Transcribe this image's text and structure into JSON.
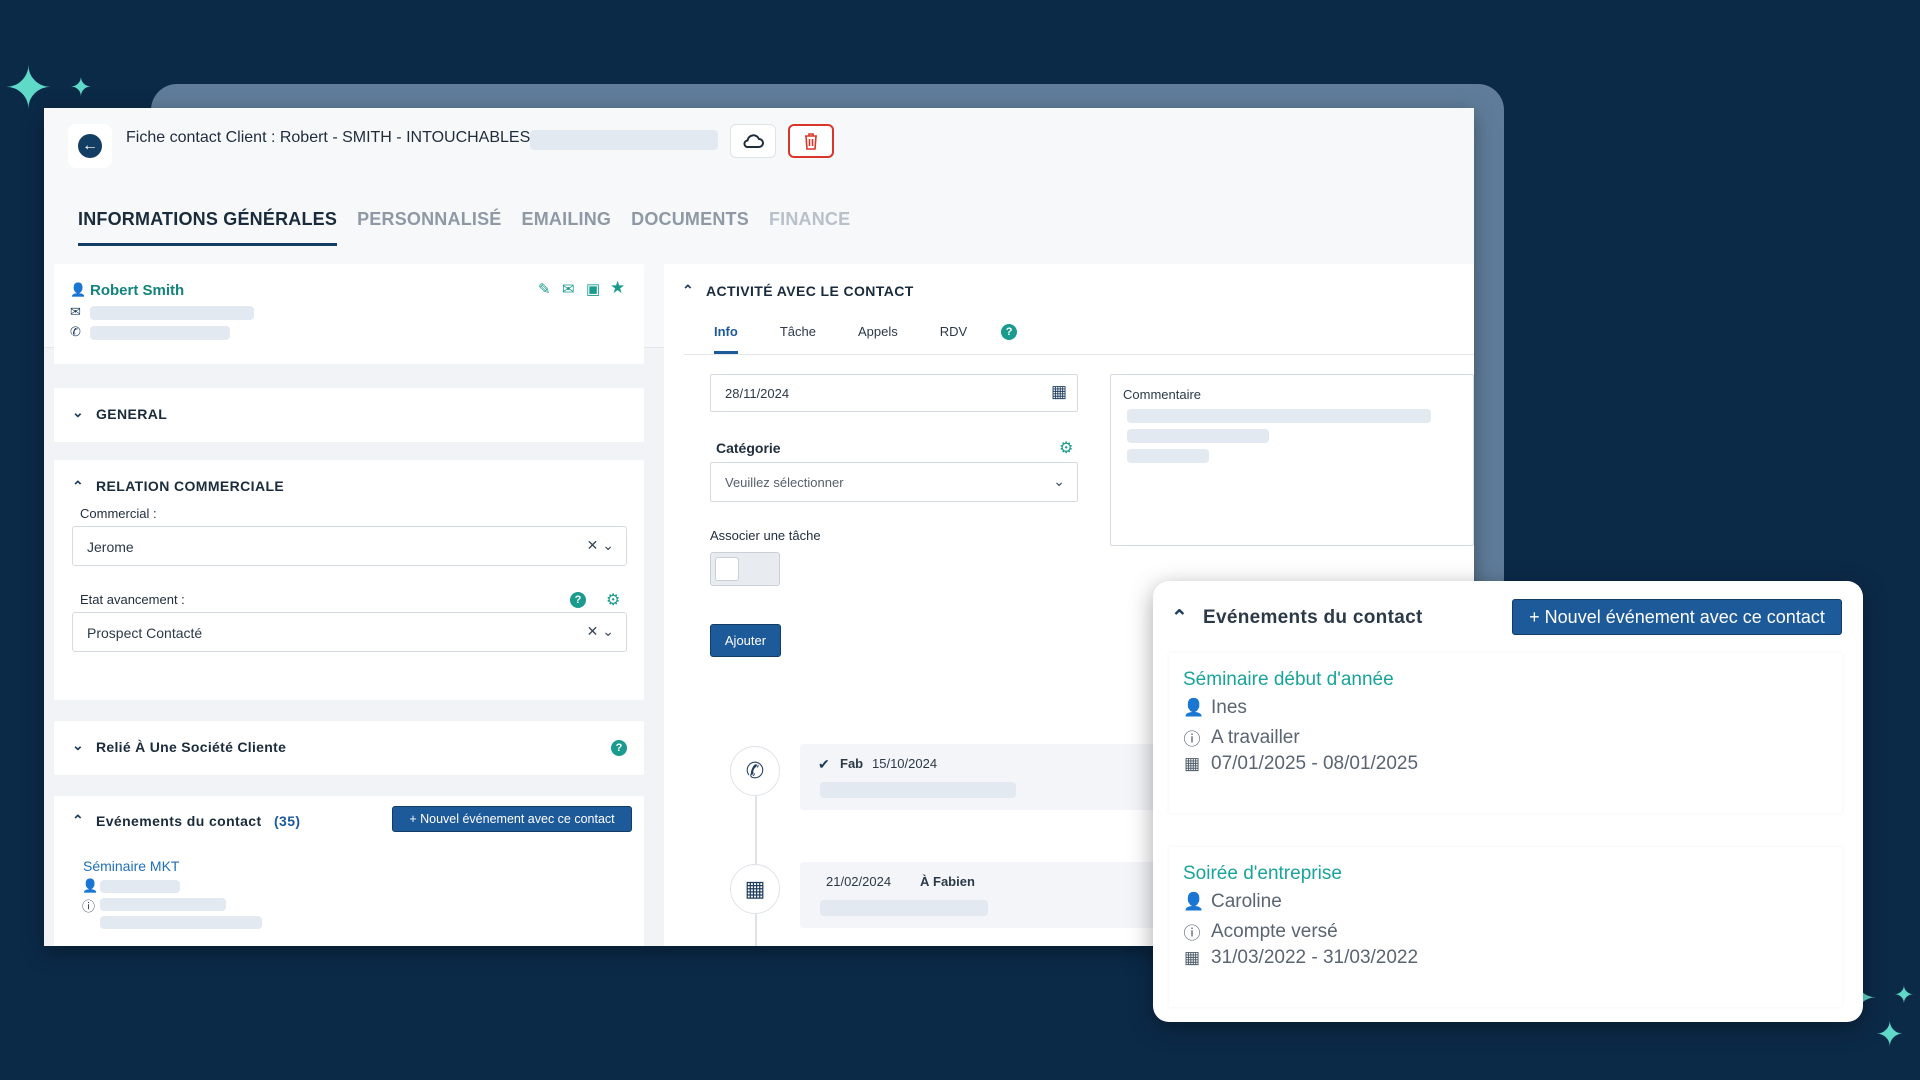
{
  "header": {
    "title": "Fiche contact Client : Robert - SMITH - INTOUCHABLES -"
  },
  "tabs": [
    {
      "label": "INFORMATIONS GÉNÉRALES"
    },
    {
      "label": "PERSONNALISÉ"
    },
    {
      "label": "EMAILING"
    },
    {
      "label": "DOCUMENTS"
    },
    {
      "label": "FINANCE"
    }
  ],
  "contact": {
    "name": "Robert Smith"
  },
  "sections": {
    "general": "GENERAL",
    "relation": "RELATION COMMERCIALE",
    "relie": "Relié À Une Société Cliente",
    "events": "Evénements du contact",
    "events_count": "(35)"
  },
  "relation": {
    "commercial_label": "Commercial :",
    "commercial_value": "Jerome",
    "etat_label": "Etat avancement :",
    "etat_value": "Prospect Contacté"
  },
  "left_events": {
    "button": "+ Nouvel événement avec ce contact",
    "first_event": "Séminaire MKT"
  },
  "activity": {
    "title": "ACTIVITÉ AVEC LE CONTACT",
    "tabs": [
      {
        "label": "Info"
      },
      {
        "label": "Tâche"
      },
      {
        "label": "Appels"
      },
      {
        "label": "RDV"
      }
    ],
    "date_value": "28/11/2024",
    "categorie_label": "Catégorie",
    "categorie_placeholder": "Veuillez sélectionner",
    "associer_label": "Associer une tâche",
    "ajouter_button": "Ajouter",
    "commentaire_label": "Commentaire",
    "timeline": [
      {
        "author": "Fab",
        "date": "15/10/2024"
      },
      {
        "date": "21/02/2024",
        "author": "À Fabien"
      }
    ]
  },
  "overlay": {
    "title": "Evénements du contact",
    "button": "+ Nouvel événement avec ce contact",
    "events": [
      {
        "title": "Séminaire début d'année",
        "person": "Ines",
        "status": "A travailler",
        "dates": "07/01/2025 - 08/01/2025"
      },
      {
        "title": "Soirée d'entreprise",
        "person": "Caroline",
        "status": "Acompte versé",
        "dates": "31/03/2022 - 31/03/2022"
      }
    ]
  },
  "colors": {
    "background": "#0b2a48",
    "accent_teal": "#1a9b8e",
    "primary_blue": "#1d5a9a",
    "danger": "#d9362b"
  }
}
